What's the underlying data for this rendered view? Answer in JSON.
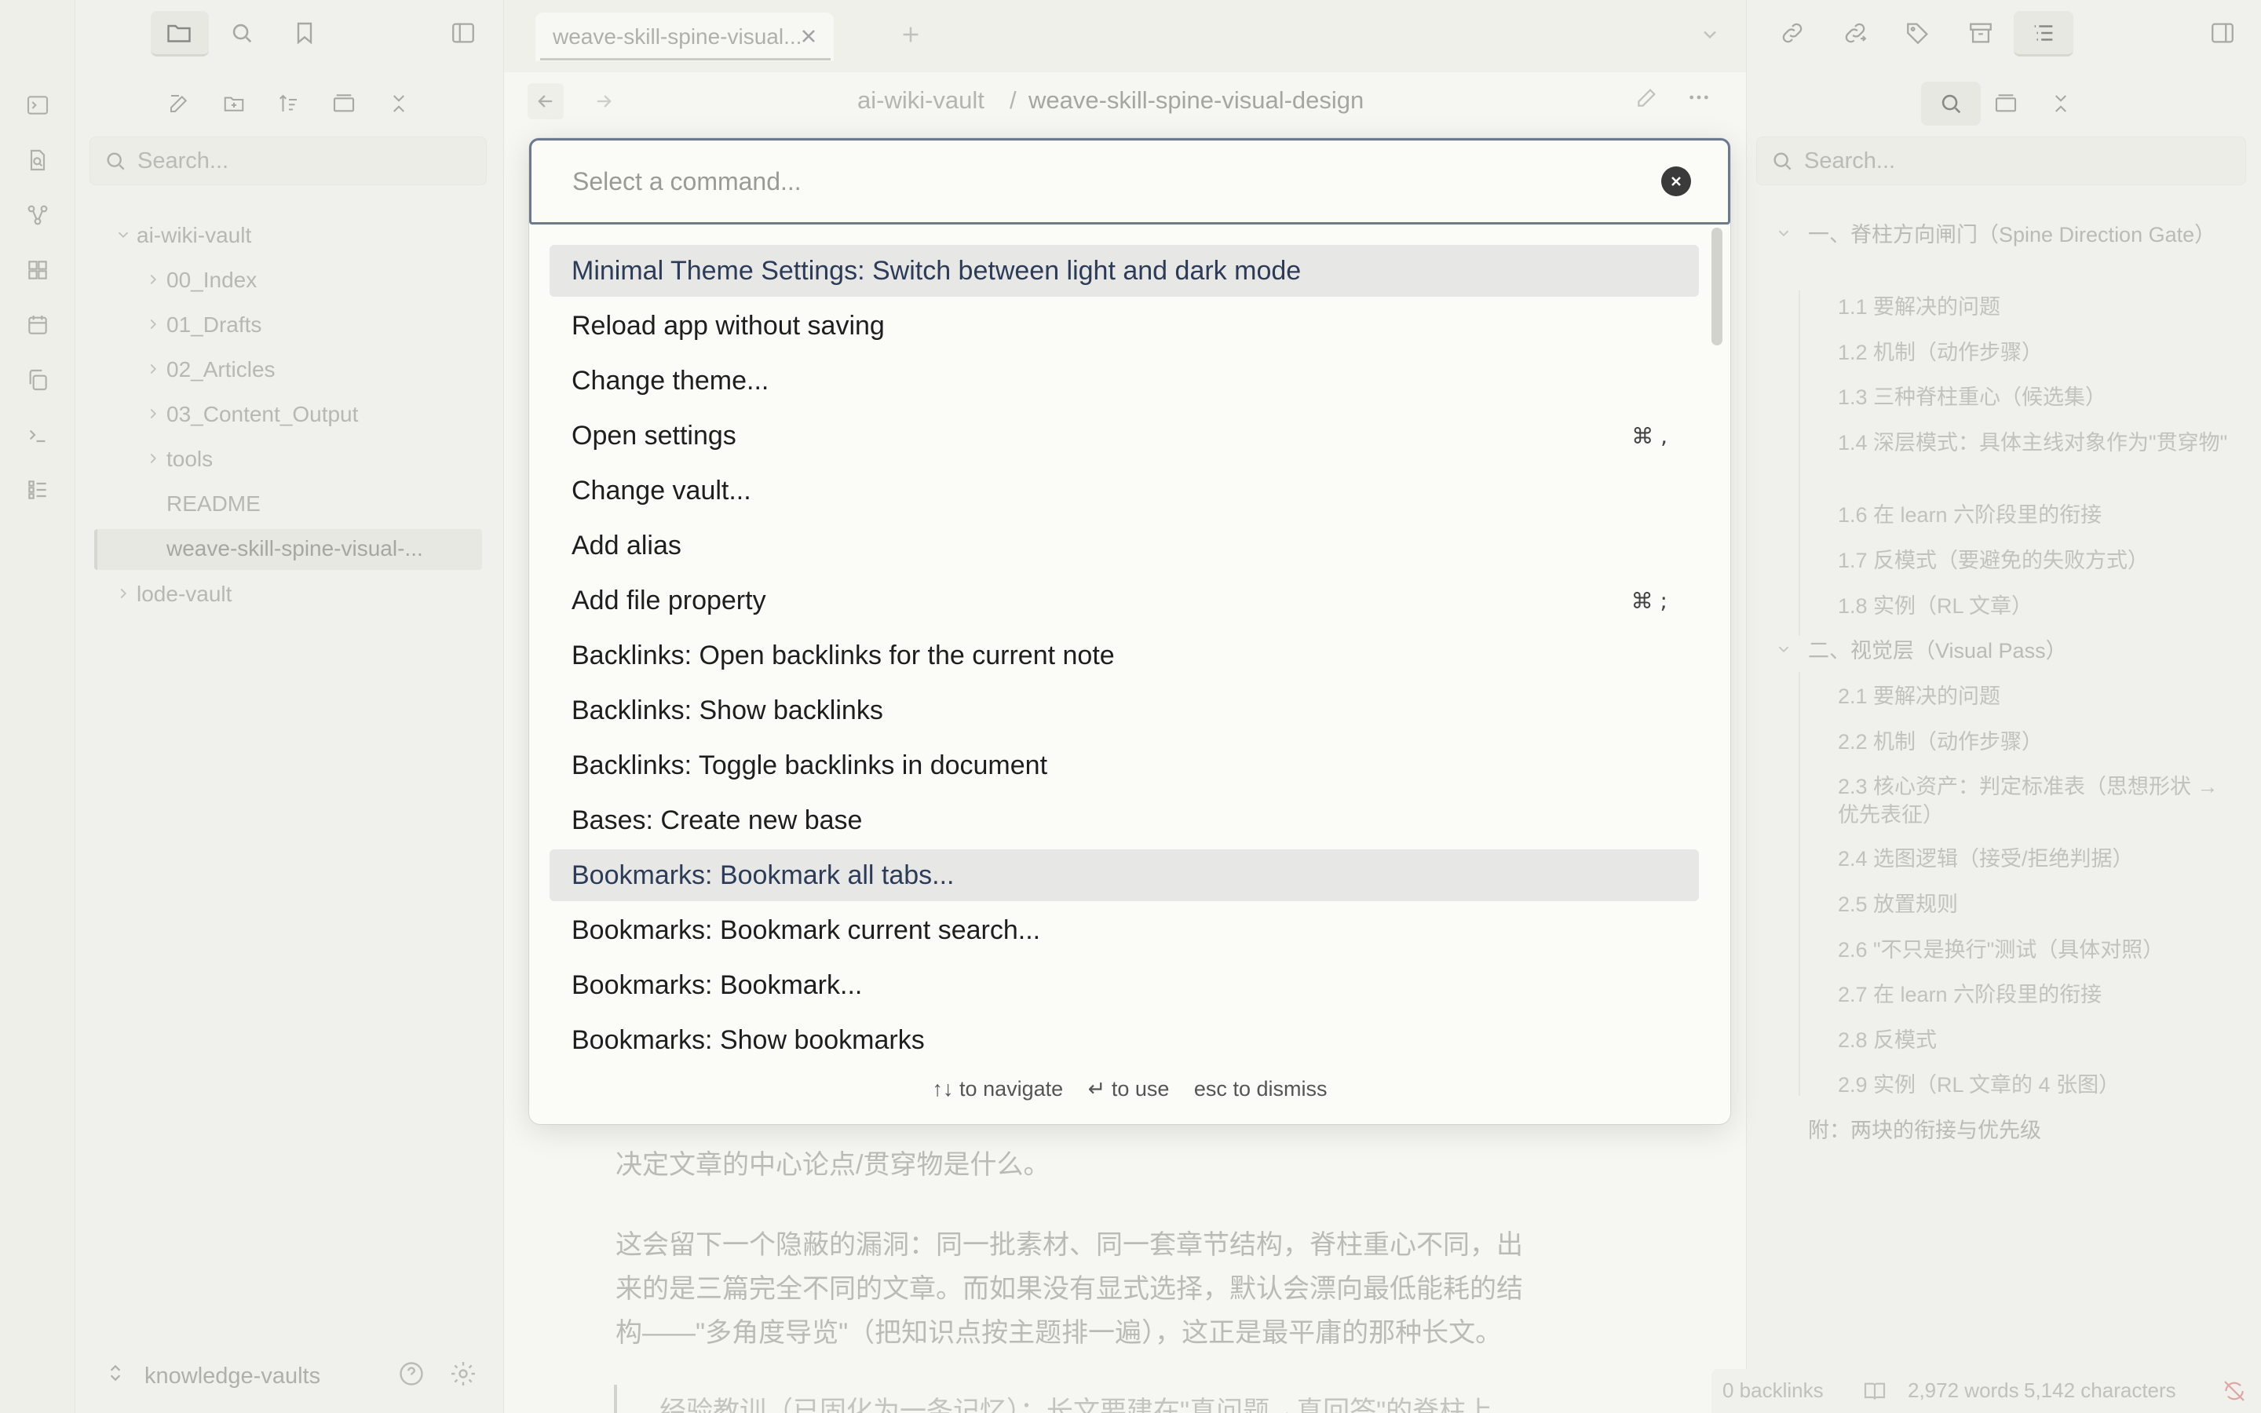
{
  "ribbon": {
    "items": [
      "terminal-icon",
      "search-file-icon",
      "graph-icon",
      "grid-icon",
      "calendar-icon",
      "copy-icon",
      "console-icon",
      "list-icon"
    ]
  },
  "left_sidebar": {
    "search_placeholder": "Search...",
    "tree": {
      "root": "ai-wiki-vault",
      "folders": [
        "00_Index",
        "01_Drafts",
        "02_Articles",
        "03_Content_Output",
        "tools"
      ],
      "files": [
        "README",
        "weave-skill-spine-visual-..."
      ],
      "other_root": "lode-vault"
    },
    "vault_switcher": "knowledge-vaults"
  },
  "tabs": {
    "active_title": "weave-skill-spine-visual...",
    "breadcrumb_vault": "ai-wiki-vault",
    "breadcrumb_sep": "/",
    "breadcrumb_file": "weave-skill-spine-visual-design"
  },
  "editor": {
    "line1": "决定文章的中心论点/贯穿物是什么。",
    "para2_line1": "这会留下一个隐蔽的漏洞：同一批素材、同一套章节结构，脊柱重心不同，出",
    "para2_line2": "来的是三篇完全不同的文章。而如果没有显式选择，默认会漂向最低能耗的结",
    "para2_line3": "构——\"多角度导览\"（把知识点按主题排一遍），这正是最平庸的那种长文。",
    "quote": "经验教训（已固化为一条记忆）：长文要建在\"真问题→真回答\"的脊柱上"
  },
  "right_sidebar": {
    "search_placeholder": "Search...",
    "outline": [
      {
        "level": 1,
        "text": "一、脊柱方向闸门（Spine Direction Gate）"
      },
      {
        "level": 2,
        "text": "1.1 要解决的问题"
      },
      {
        "level": 2,
        "text": "1.2 机制（动作步骤）"
      },
      {
        "level": 2,
        "text": "1.3 三种脊柱重心（候选集）"
      },
      {
        "level": 2,
        "text": "1.4 深层模式：具体主线对象作为\"贯穿物\""
      },
      {
        "level": 2,
        "text": "1.6 在 learn 六阶段里的衔接"
      },
      {
        "level": 2,
        "text": "1.7 反模式（要避免的失败方式）"
      },
      {
        "level": 2,
        "text": "1.8 实例（RL 文章）"
      },
      {
        "level": 1,
        "text": "二、视觉层（Visual Pass）"
      },
      {
        "level": 2,
        "text": "2.1 要解决的问题"
      },
      {
        "level": 2,
        "text": "2.2 机制（动作步骤）"
      },
      {
        "level": 2,
        "text": "2.3 核心资产：判定标准表（思想形状 → 优先表征）"
      },
      {
        "level": 2,
        "text": "2.4 选图逻辑（接受/拒绝判据）"
      },
      {
        "level": 2,
        "text": "2.5 放置规则"
      },
      {
        "level": 2,
        "text": "2.6 \"不只是换行\"测试（具体对照）"
      },
      {
        "level": 2,
        "text": "2.7 在 learn 六阶段里的衔接"
      },
      {
        "level": 2,
        "text": "2.8 反模式"
      },
      {
        "level": 2,
        "text": "2.9 实例（RL 文章的 4 张图）"
      },
      {
        "level": 0,
        "text": "附：两块的衔接与优先级"
      }
    ]
  },
  "status_bar": {
    "backlinks": "0 backlinks",
    "words": "2,972 words",
    "characters": "5,142 characters"
  },
  "command_palette": {
    "placeholder": "Select a command...",
    "commands": [
      {
        "label": "Minimal Theme Settings: Switch between light and dark mode",
        "hotkey": "",
        "selected": true
      },
      {
        "label": "Reload app without saving",
        "hotkey": ""
      },
      {
        "label": "Change theme...",
        "hotkey": ""
      },
      {
        "label": "Open settings",
        "hotkey": "⌘ ,"
      },
      {
        "label": "Change vault...",
        "hotkey": ""
      },
      {
        "label": "Add alias",
        "hotkey": ""
      },
      {
        "label": "Add file property",
        "hotkey": "⌘ ;"
      },
      {
        "label": "Backlinks: Open backlinks for the current note",
        "hotkey": ""
      },
      {
        "label": "Backlinks: Show backlinks",
        "hotkey": ""
      },
      {
        "label": "Backlinks: Toggle backlinks in document",
        "hotkey": ""
      },
      {
        "label": "Bases: Create new base",
        "hotkey": ""
      },
      {
        "label": "Bookmarks: Bookmark all tabs...",
        "hotkey": "",
        "hovered": true
      },
      {
        "label": "Bookmarks: Bookmark current search...",
        "hotkey": ""
      },
      {
        "label": "Bookmarks: Bookmark...",
        "hotkey": ""
      },
      {
        "label": "Bookmarks: Show bookmarks",
        "hotkey": ""
      }
    ],
    "footer": {
      "navigate_keys": "↑↓",
      "navigate_text": "to navigate",
      "use_key": "↵",
      "use_text": "to use",
      "dismiss_key": "esc",
      "dismiss_text": "to dismiss"
    }
  },
  "colors": {
    "selection_bg": "#e7e7e5",
    "selection_text": "#2c3b57",
    "input_border": "#6b7a8f"
  }
}
